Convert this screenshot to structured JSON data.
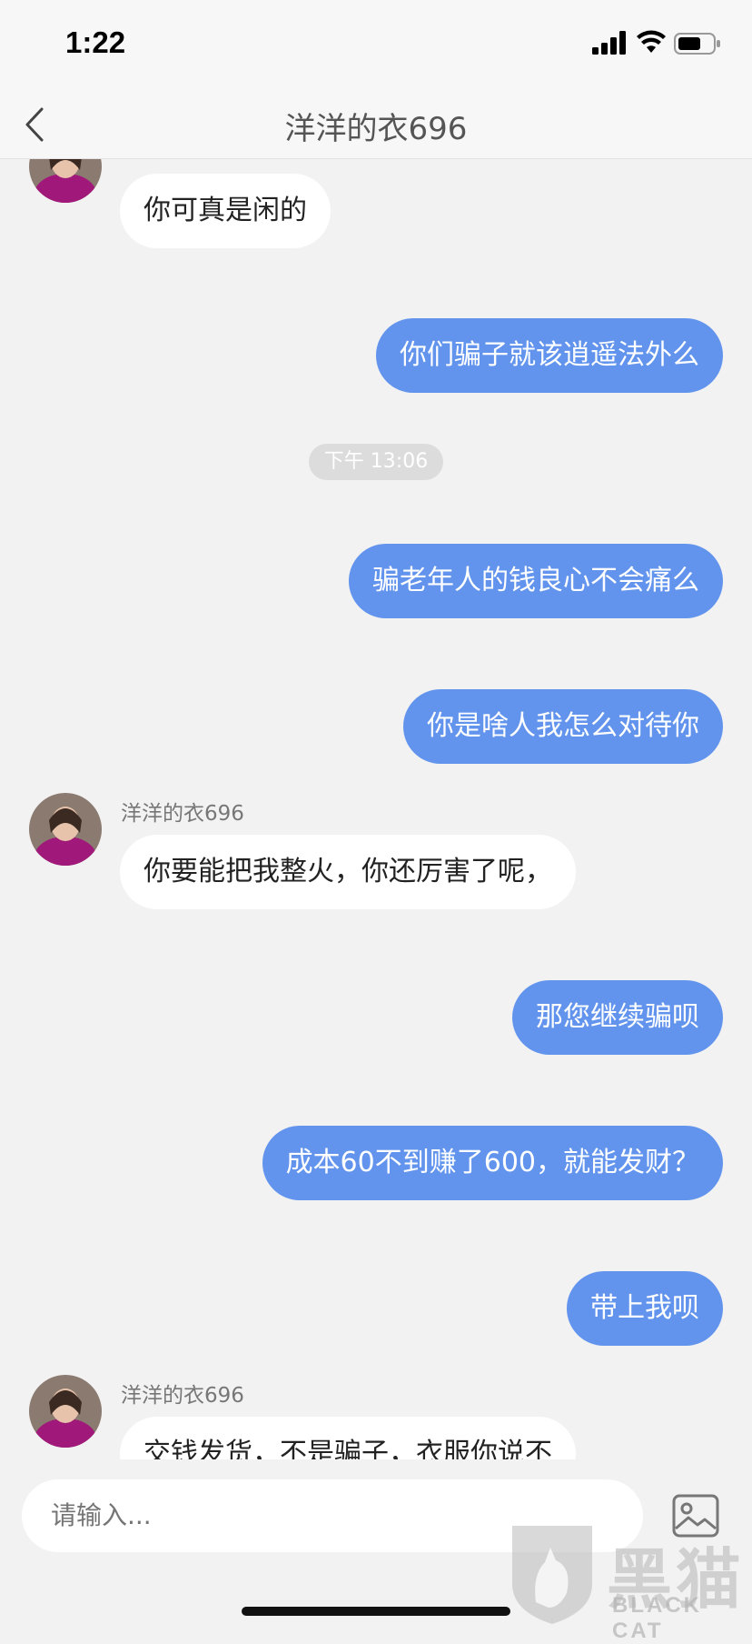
{
  "status_bar": {
    "time": "1:22"
  },
  "header": {
    "title": "洋洋的衣696"
  },
  "chat": {
    "contact_name": "洋洋的衣696",
    "timestamp": "下午 13:06",
    "messages": [
      {
        "side": "in",
        "text": "你可真是闲的"
      },
      {
        "side": "out",
        "text": "你们骗子就该逍遥法外么"
      },
      {
        "side": "out",
        "text": "骗老年人的钱良心不会痛么"
      },
      {
        "side": "out",
        "text": "你是啥人我怎么对待你"
      },
      {
        "side": "in",
        "text": "你要能把我整火，你还厉害了呢，"
      },
      {
        "side": "out",
        "text": "那您继续骗呗"
      },
      {
        "side": "out",
        "text": "成本60不到赚了600，就能发财？"
      },
      {
        "side": "out",
        "text": "带上我呗"
      },
      {
        "side": "in",
        "text": "交钱发货，不是骗子，衣服你说不"
      }
    ]
  },
  "input": {
    "placeholder": "请输入..."
  },
  "watermark": {
    "text": "黑猫",
    "sub": "BLACK CAT"
  },
  "colors": {
    "outgoing_bubble": "#6294ee",
    "incoming_bubble": "#ffffff",
    "background": "#f2f2f2"
  }
}
